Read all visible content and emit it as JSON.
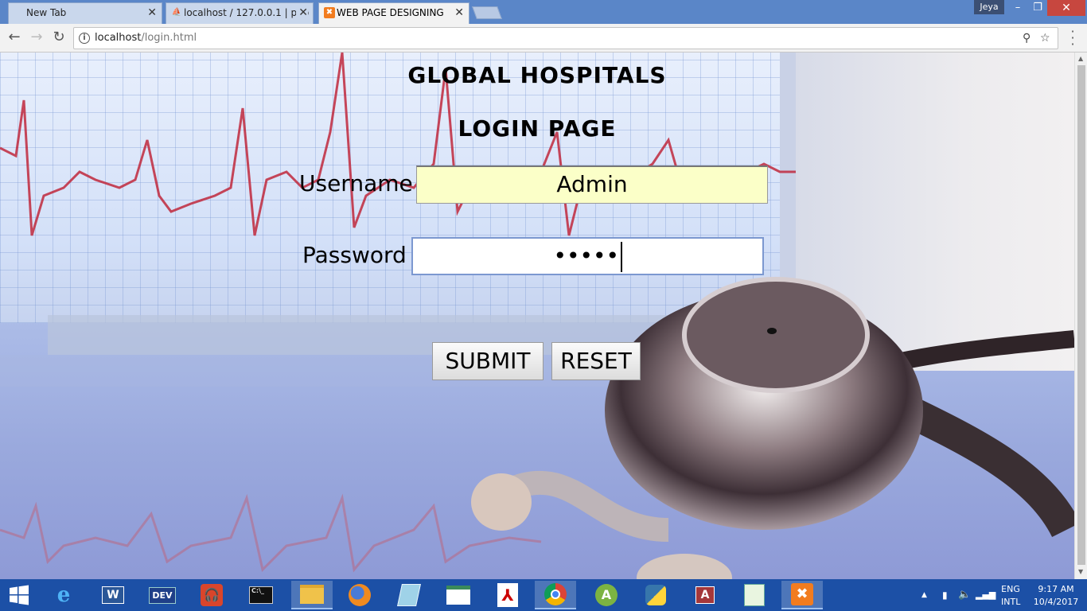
{
  "browser": {
    "tabs": [
      {
        "label": "New Tab",
        "active": false
      },
      {
        "label": "localhost / 127.0.0.1 | php",
        "active": false
      },
      {
        "label": "WEB PAGE DESIGNING",
        "active": true
      }
    ],
    "profile": "Jeya",
    "url_host": "localhost",
    "url_path": "/login.html"
  },
  "page": {
    "site_title": "GLOBAL HOSPITALS",
    "form_title": "LOGIN PAGE",
    "username_label": "Username",
    "username_value": "Admin",
    "password_label": "Password",
    "password_mask": "•••••",
    "submit_label": "SUBMIT",
    "reset_label": "RESET"
  },
  "taskbar": {
    "items": [
      "start-icon",
      "internet-explorer-icon",
      "word-icon",
      "devcpp-icon",
      "headphones-app-icon",
      "cmd-icon",
      "file-explorer-icon",
      "firefox-icon",
      "notepad-icon",
      "spreadsheet-icon",
      "acrobat-icon",
      "chrome-icon",
      "android-studio-icon",
      "python-icon",
      "access-icon",
      "editor-icon",
      "xampp-icon"
    ],
    "devcpp_label": "DEV",
    "word_label": "W",
    "access_label": "A",
    "lang_top": "ENG",
    "lang_bottom": "INTL",
    "time": "9:17 AM",
    "date": "10/4/2017"
  }
}
